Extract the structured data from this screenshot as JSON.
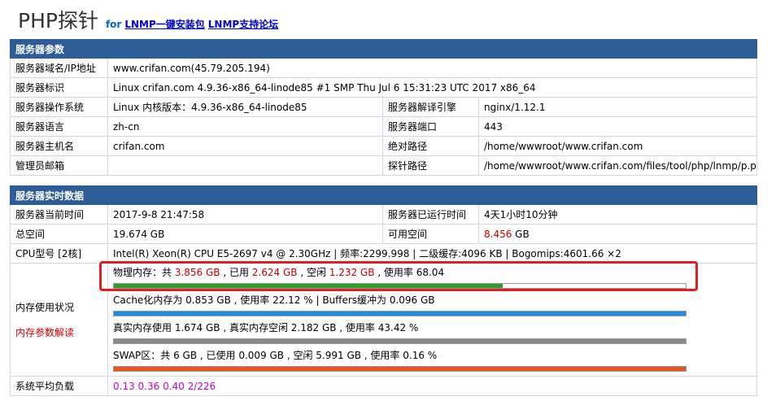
{
  "header": {
    "title": "PHP探针",
    "for_text": "for",
    "link1": "LNMP一键安装包",
    "link2": "LNMP支持论坛"
  },
  "server_params": {
    "section_title": "服务器参数",
    "rows": {
      "domain_label": "服务器域名/IP地址",
      "domain_value": "www.crifan.com(45.79.205.194)",
      "id_label": "服务器标识",
      "id_value": "Linux crifan.com 4.9.36-x86_64-linode85 #1 SMP Thu Jul 6 15:31:23 UTC 2017 x86_64",
      "os_label": "服务器操作系统",
      "os_value": "Linux  内核版本：4.9.36-x86_64-linode85",
      "engine_label": "服务器解译引擎",
      "engine_value": "nginx/1.12.1",
      "lang_label": "服务器语言",
      "lang_value": "zh-cn",
      "port_label": "服务器端口",
      "port_value": "443",
      "host_label": "服务器主机名",
      "host_value": "crifan.com",
      "abspath_label": "绝对路径",
      "abspath_value": "/home/wwwroot/www.crifan.com",
      "admin_label": "管理员邮箱",
      "admin_value": "",
      "probe_label": "探针路径",
      "probe_value": "/home/wwwroot/www.crifan.com/files/tool/php/lnmp/p.php"
    }
  },
  "realtime": {
    "section_title": "服务器实时数据",
    "time_label": "服务器当前时间",
    "time_value": "2017-9-8 21:47:58",
    "uptime_label": "服务器已运行时间",
    "uptime_value": "4天1小时10分钟",
    "total_label": "总空间",
    "total_value": "19.674 GB",
    "avail_label": "可用空间",
    "avail_num": "8.456",
    "avail_unit": " GB",
    "cpu_label": "CPU型号 [2核]",
    "cpu_value": "Intel(R) Xeon(R) CPU E5-2697 v4 @ 2.30GHz | 频率:2299.998 | 二级缓存:4096 KB | Bogomips:4601.66 ×2",
    "mem_label": "内存使用状况",
    "mem_help": "内存参数解读",
    "physical": {
      "p1": "物理内存：共 ",
      "total": "3.856 GB",
      "p2": " , 已用 ",
      "used": "2.624 GB",
      "p3": " , 空闲 ",
      "free": "1.232 GB",
      "p4": " , 使用率 68.04",
      "usage_pct": 68.04,
      "color": "#2aa02a"
    },
    "cache": {
      "text": "Cache化内存为 0.853 GB , 使用率 22.12 % | Buffers缓冲为 0.096 GB",
      "usage_pct": 100,
      "color": "#1e8ee8"
    },
    "real": {
      "text": "真实内存使用 1.674 GB , 真实内存空闲 2.182 GB , 使用率 43.42 %",
      "usage_pct": 100,
      "color": "#8a8a8a"
    },
    "swap": {
      "text": "SWAP区：共 6 GB , 已使用 0.009 GB , 空闲 5.991 GB , 使用率 0.16 %",
      "usage_pct": 100,
      "color": "#e8541e"
    },
    "load_label": "系统平均负载",
    "load_value": "0.13 0.36 0.40 2/226"
  }
}
